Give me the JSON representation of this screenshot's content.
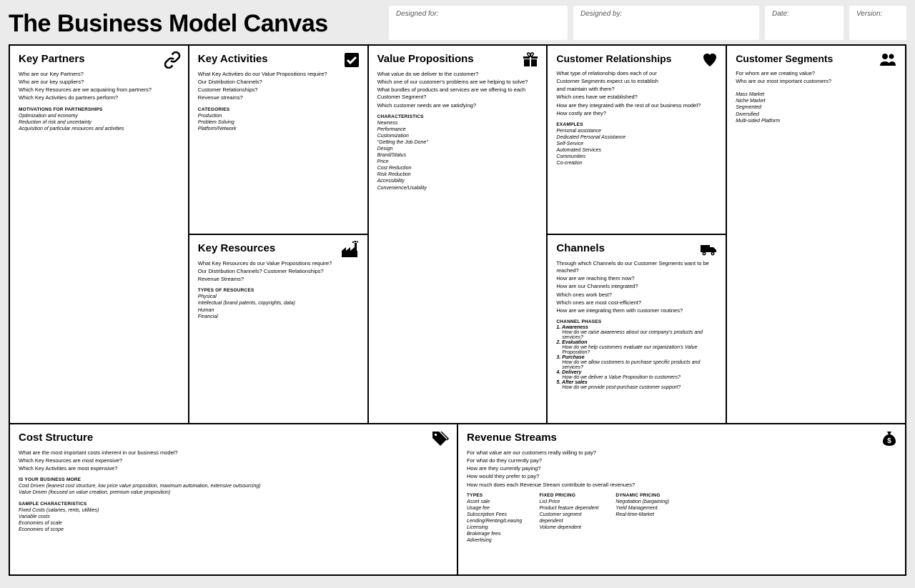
{
  "title": "The Business Model Canvas",
  "meta": {
    "designed_for": "Designed for:",
    "designed_by": "Designed by:",
    "date": "Date:",
    "version": "Version:"
  },
  "key_partners": {
    "title": "Key Partners",
    "q1": "Who are our Key Partners?",
    "q2": "Who are our key suppliers?",
    "q3": "Which Key Resources are we acquairing from partners?",
    "q4": "Which Key Activities do partners perform?",
    "sub": "MOTIVATIONS FOR PARTNERSHIPS",
    "i1": "Optimization and economy",
    "i2": "Reduction of risk and uncertainty",
    "i3": "Acquisition of particular resources and activities"
  },
  "key_activities": {
    "title": "Key Activities",
    "q1": "What Key Activities do our Value Propositions require?",
    "q2": "Our Distribution Channels?",
    "q3": "Customer Relationships?",
    "q4": "Revenue streams?",
    "sub": "CATEGORIES",
    "i1": "Production",
    "i2": "Problem Solving",
    "i3": "Platform/Network"
  },
  "key_resources": {
    "title": "Key Resources",
    "q1": "What Key Resources do our Value Propositions require?",
    "q2": "Our Distribution Channels? Customer Relationships?",
    "q3": "Revenue Streams?",
    "sub": "TYPES OF RESOURCES",
    "i1": "Physical",
    "i2": "Intellectual (brand patents, copyrights, data)",
    "i3": "Human",
    "i4": "Financial"
  },
  "value_prop": {
    "title": "Value Propositions",
    "q1": "What value do we deliver to the customer?",
    "q2": "Which one of our customer's problems are we helping to solve?",
    "q3": "What bundles of products and services are we offering to each Customer Segment?",
    "q4": "Which customer needs are we satisfying?",
    "sub": "CHARACTERISTICS",
    "i1": "Newness",
    "i2": "Performance",
    "i3": "Customization",
    "i4": "\"Getting the Job Done\"",
    "i5": "Design",
    "i6": "Brand/Status",
    "i7": "Price",
    "i8": "Cost Reduction",
    "i9": "Risk Reduction",
    "i10": "Accessibility",
    "i11": "Convenience/Usability"
  },
  "cust_rel": {
    "title": "Customer Relationships",
    "q1": "What type of relationship does each of our",
    "q2": "Customer Segments expect us to establish",
    "q3": "and maintain with them?",
    "q4": "Which ones have we established?",
    "q5": "How are they integrated with the rest of our business model?",
    "q6": "How costly are they?",
    "sub": "EXAMPLES",
    "i1": "Personal assistance",
    "i2": "Dedicated Personal Assistance",
    "i3": "Self-Service",
    "i4": "Automated Services",
    "i5": "Communities",
    "i6": "Co-creation"
  },
  "channels": {
    "title": "Channels",
    "q1": "Through which Channels do our Customer Segments want to be reached?",
    "q2": "How are we reaching them now?",
    "q3": "How are our Channels integrated?",
    "q4": "Which ones work best?",
    "q5": "Which ones are most cost-efficient?",
    "q6": "How are we integrating them with customer routines?",
    "sub": "CHANNEL PHASES",
    "p1n": "1. Awareness",
    "p1d": "How do we raise awareness about our company's products and services?",
    "p2n": "2. Evaluation",
    "p2d": "How do we help customers evaluate our organization's Value Proposition?",
    "p3n": "3. Purchase",
    "p3d": "How do we allow customers to purchase specific products and services?",
    "p4n": "4. Delivery",
    "p4d": "How do we deliver a Value Proposition to customers?",
    "p5n": "5. After sales",
    "p5d": "How do we provide post-purchase customer support?"
  },
  "cust_seg": {
    "title": "Customer Segments",
    "q1": "For whom are we creating value?",
    "q2": "Who are our most important customers?",
    "i1": "Mass Market",
    "i2": "Niche Market",
    "i3": "Segmented",
    "i4": "Diversified",
    "i5": "Multi-sided Platform"
  },
  "cost": {
    "title": "Cost Structure",
    "q1": "What are the most important costs inherent in our business model?",
    "q2": "Which Key Resources are most expensive?",
    "q3": "Which Key Activities are most expensive?",
    "sub1": "IS YOUR BUSINESS MORE",
    "i1": "Cost Driven (leanest cost structure, low price value proposition, maximum automation, extensive outsourcing)",
    "i2": "Value Driven (focused on value creation, premium value proposition)",
    "sub2": "SAMPLE CHARACTERISTICS",
    "i3": "Fixed Costs (salaries, rents, utilities)",
    "i4": "Variable costs",
    "i5": "Economies of scale",
    "i6": "Economies of scope"
  },
  "revenue": {
    "title": "Revenue Streams",
    "q1": "For what value are our customers really willing to pay?",
    "q2": "For what do they currently pay?",
    "q3": "How are they currently paying?",
    "q4": "How would they prefer to pay?",
    "q5": "How much does each Revenue Stream contribute to overall revenues?",
    "c1h": "TYPES",
    "c1i1": "Asset sale",
    "c1i2": "Usage fee",
    "c1i3": "Subscription Fees",
    "c1i4": "Lending/Renting/Leasing",
    "c1i5": "Licensing",
    "c1i6": "Brokerage fees",
    "c1i7": "Advertising",
    "c2h": "FIXED PRICING",
    "c2i1": "List Price",
    "c2i2": "Product feature dependent",
    "c2i3": "Customer segment",
    "c2i4": "dependent",
    "c2i5": "Volume dependent",
    "c3h": "DYNAMIC PRICING",
    "c3i1": "Negotiation (bargaining)",
    "c3i2": "Yield Management",
    "c3i3": "Real-time-Market"
  }
}
